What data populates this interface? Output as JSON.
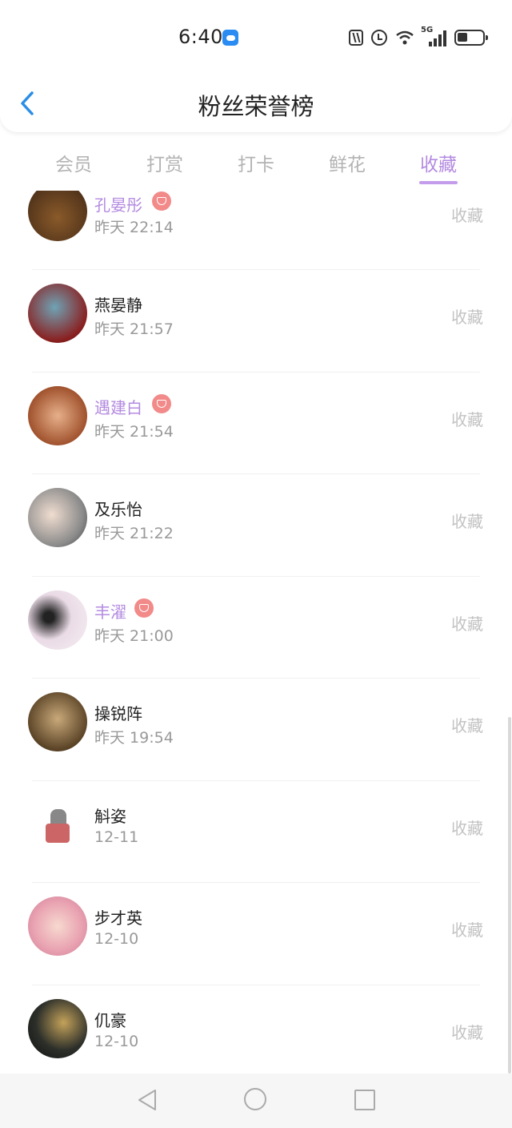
{
  "status_bar": {
    "time": "6:40",
    "network": "5G"
  },
  "header": {
    "title": "粉丝荣誉榜"
  },
  "tabs": [
    {
      "label": "会员",
      "active": false
    },
    {
      "label": "打赏",
      "active": false
    },
    {
      "label": "打卡",
      "active": false
    },
    {
      "label": "鲜花",
      "active": false
    },
    {
      "label": "收藏",
      "active": true
    }
  ],
  "colors": {
    "accent": "#b48be0",
    "badge": "#f28a8a",
    "action_text": "#c2c2c2"
  },
  "fans": [
    {
      "name": "孔晏彤",
      "date": "昨天 22:14",
      "action": "收藏",
      "vip": true
    },
    {
      "name": "燕晏静",
      "date": "昨天 21:57",
      "action": "收藏",
      "vip": false
    },
    {
      "name": "遇建白",
      "date": "昨天 21:54",
      "action": "收藏",
      "vip": true
    },
    {
      "name": "及乐怡",
      "date": "昨天 21:22",
      "action": "收藏",
      "vip": false
    },
    {
      "name": "丰濯",
      "date": "昨天 21:00",
      "action": "收藏",
      "vip": true
    },
    {
      "name": "操锐阵",
      "date": "昨天 19:54",
      "action": "收藏",
      "vip": false
    },
    {
      "name": "斛姿",
      "date": "12-11",
      "action": "收藏",
      "vip": false
    },
    {
      "name": "步才英",
      "date": "12-10",
      "action": "收藏",
      "vip": false
    },
    {
      "name": "仉豪",
      "date": "12-10",
      "action": "收藏",
      "vip": false
    }
  ]
}
